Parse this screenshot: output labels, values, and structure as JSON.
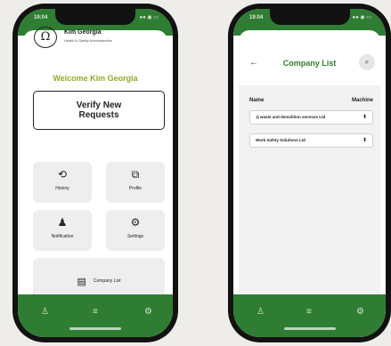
{
  "left_screen": {
    "status": {
      "time": "19:04",
      "icons": "●● ◉ ▭"
    },
    "profile": {
      "name": "Kim Georgia",
      "role": "Health & Safety Administration",
      "logo_glyph": "Ω"
    },
    "welcome": "Welcome Kim Georgia",
    "verify_button": "Verify New Requests",
    "tiles": {
      "history": {
        "icon": "history-icon",
        "glyph": "⟲",
        "label": "History"
      },
      "profile": {
        "icon": "profile-icon",
        "glyph": "⧉",
        "label": "Profile"
      },
      "notification": {
        "icon": "notification-icon",
        "glyph": "♟",
        "label": "Notification"
      },
      "settings": {
        "icon": "settings-icon",
        "glyph": "⚙",
        "label": "Settings"
      }
    },
    "company_list": {
      "icon": "list-icon",
      "glyph": "▤",
      "label": "Company List"
    },
    "nav": {
      "person": "♙",
      "menu": "≡",
      "settings": "⚙"
    }
  },
  "right_screen": {
    "status": {
      "time": "19:04",
      "icons": "●● ◉ ▭"
    },
    "title": "Company List",
    "back_glyph": "←",
    "search_glyph": "⌕",
    "columns": {
      "name": "Name",
      "machine": "Machine"
    },
    "rows": [
      {
        "name": "Jj waste and demolition services Ltd",
        "chev": "⬍"
      },
      {
        "name": "Work Safety Solutions Ltd",
        "chev": "⬍"
      }
    ],
    "nav": {
      "person": "♙",
      "menu": "≡",
      "settings": "⚙"
    }
  },
  "colors": {
    "brand_green": "#2f7d33",
    "welcome_green": "#8fac2a",
    "tile_bg": "#eeeeee"
  }
}
